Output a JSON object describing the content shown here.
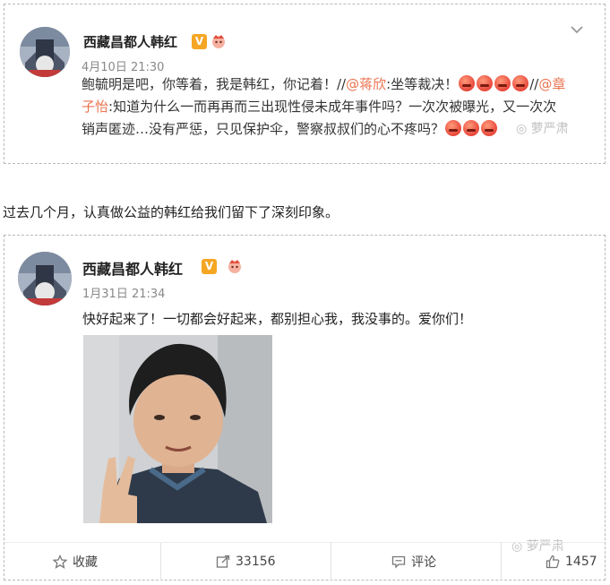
{
  "post1": {
    "username": "西藏昌都人韩红",
    "verified_badge": "V",
    "time": "4月10日 21:30",
    "text_line1_part1": "鲍毓明是吧，你等着，我是韩红，你记着！//",
    "mention1": "@蒋欣",
    "text_line1_part2": ":坐等裁决！",
    "text_line1_part3": "//",
    "mention2_part1": "@章",
    "mention2_part2": "子怡",
    "text_line2": ":知道为什么一而再再而三出现性侵未成年事件吗？一次次被曝光，又一次次",
    "text_line3": "销声匿迹…没有严惩，只见保护伞，警察叔叔们的心不疼吗？",
    "watermark": "萝严肃"
  },
  "middle_text": "过去几个月，认真做公益的韩红给我们留下了深刻印象。",
  "post2": {
    "username": "西藏昌都人韩红",
    "verified_badge": "V",
    "time": "1月31日 21:34",
    "text": "快好起来了！一切都会好起来，都别担心我，我没事的。爱你们！",
    "watermark": "萝严肃",
    "actions": {
      "favorite_label": "收藏",
      "repost_count": "33156",
      "comment_label": "评论",
      "like_count": "1457"
    }
  }
}
